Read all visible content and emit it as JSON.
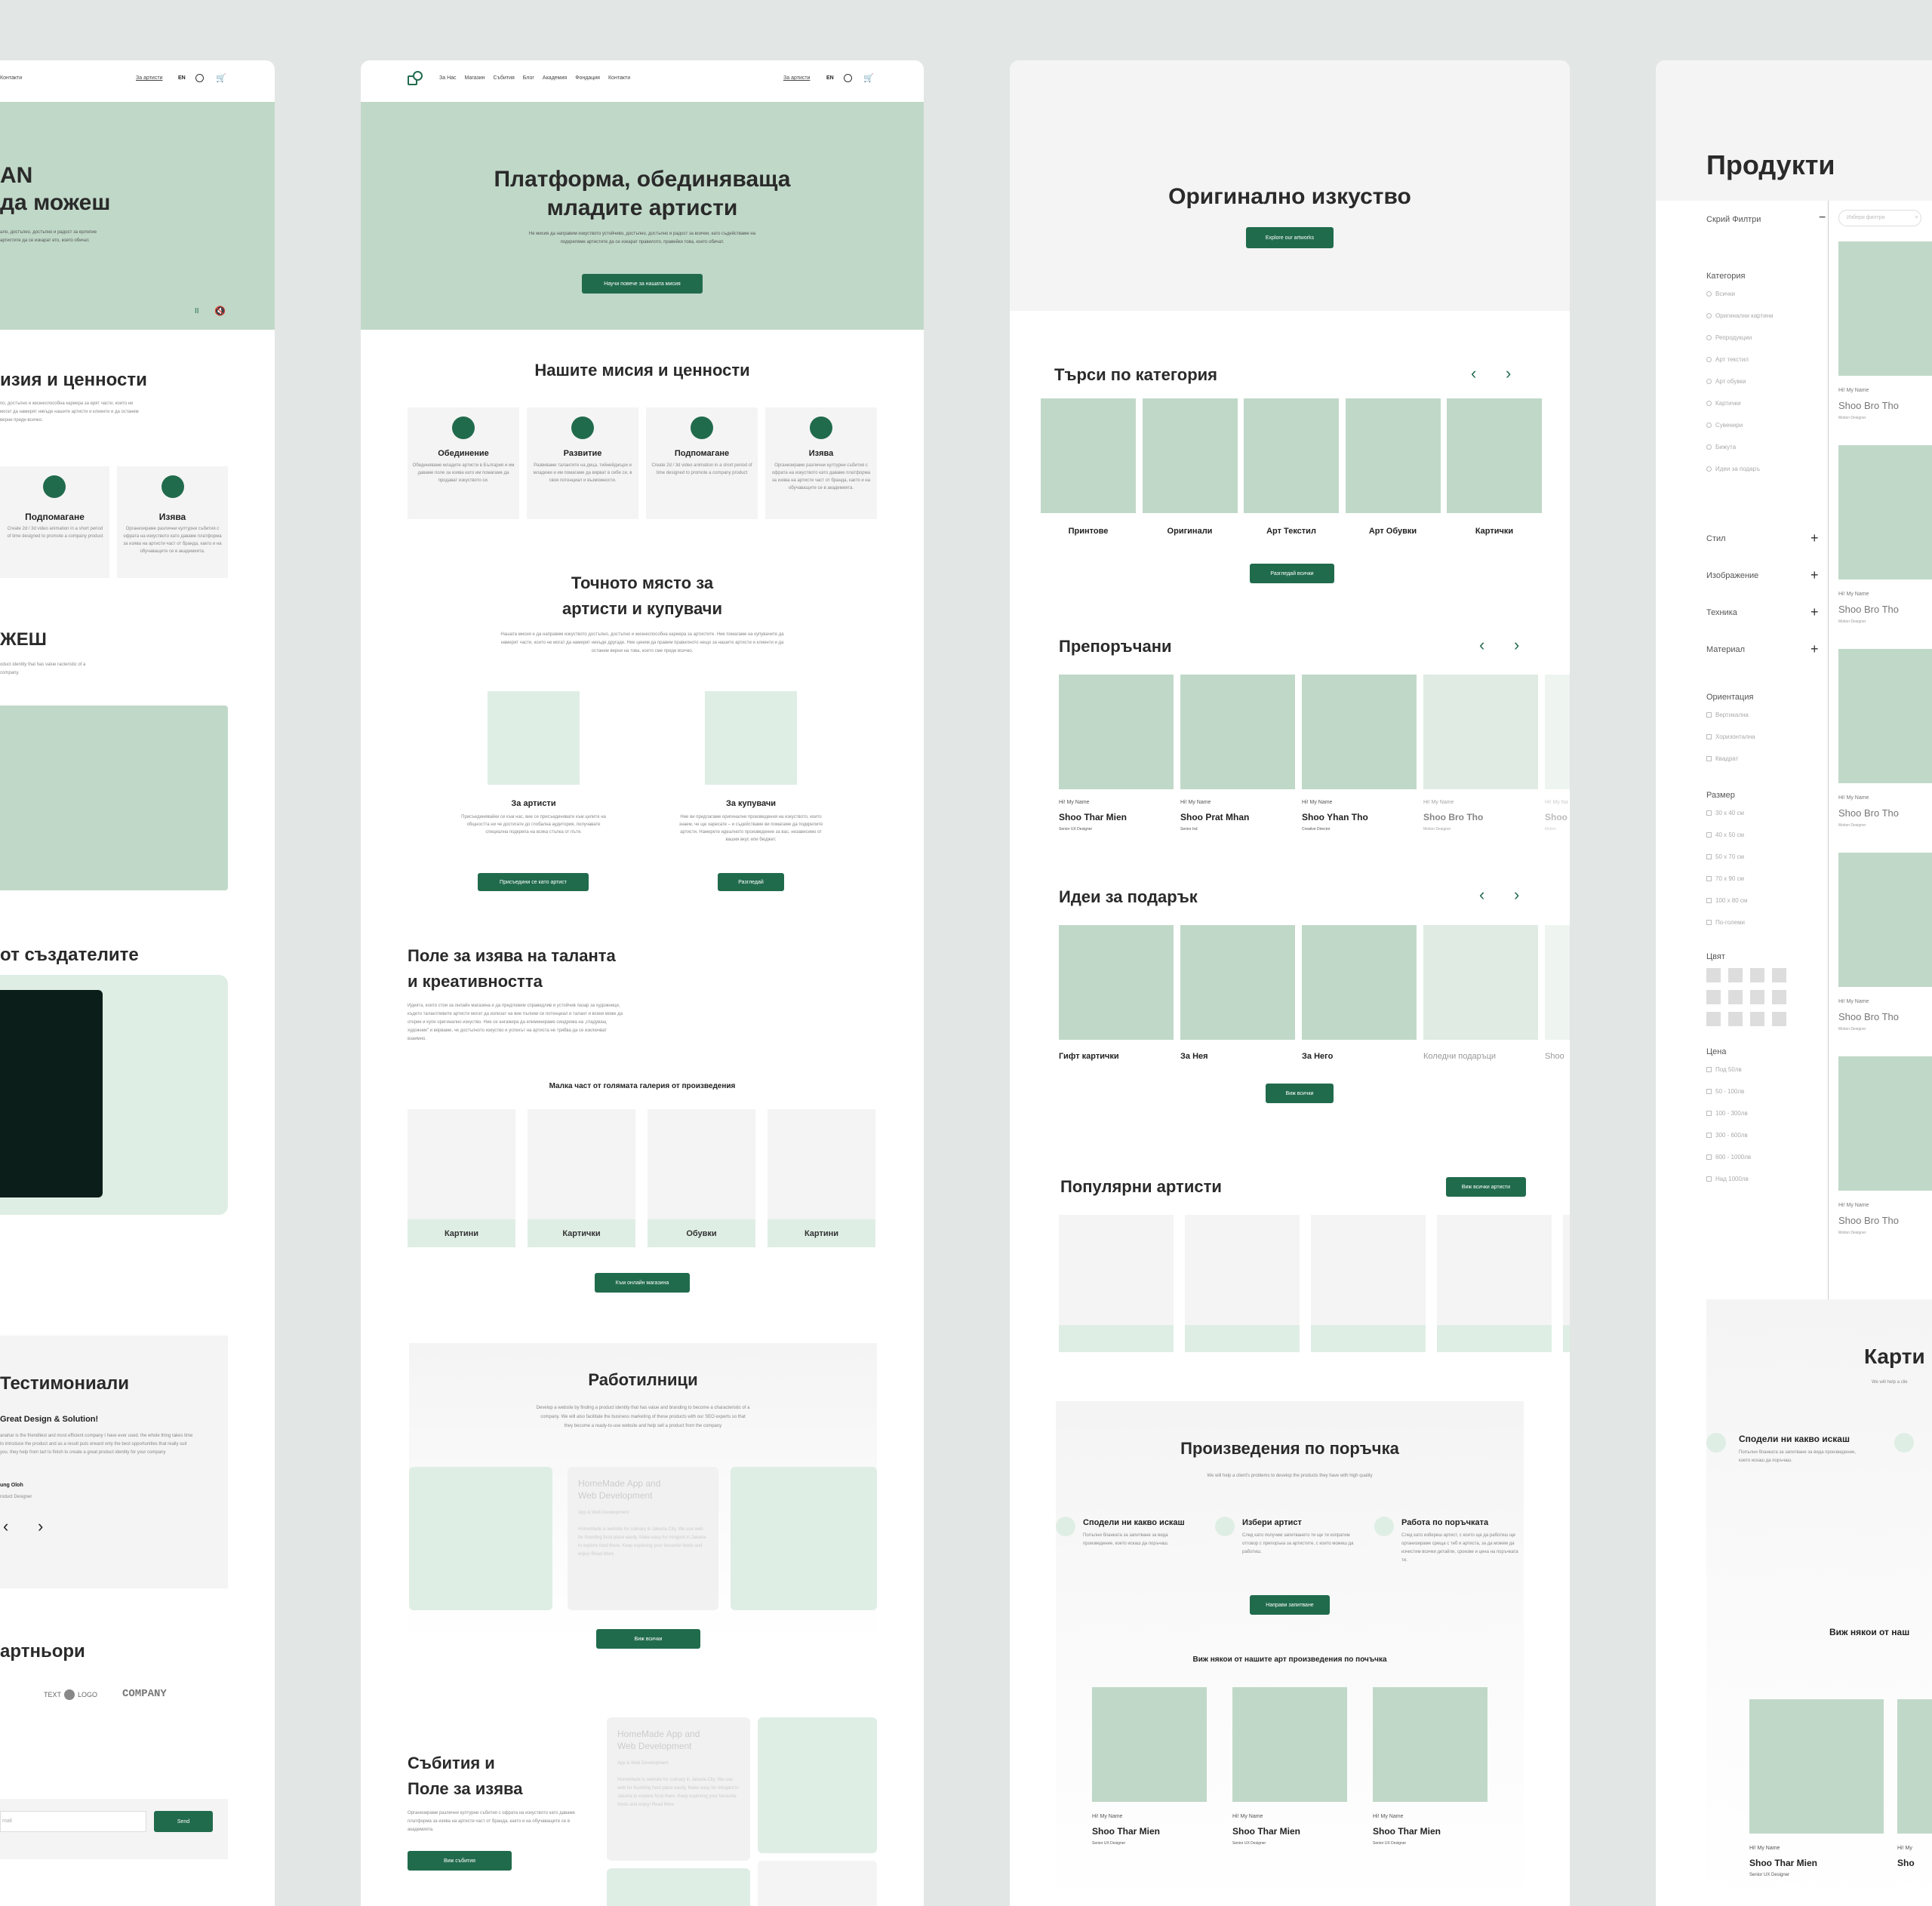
{
  "panel1": {
    "nav_contacts": "Контакти",
    "nav_artists": "За артисти",
    "lang": "EN",
    "hero_title_line1": "AN",
    "hero_title_line2": "да можеш",
    "hero_text": "ало, достъпно, достъпно и радост за ерлопие артистите да се изкарат ето, което обичат.",
    "pause": "II",
    "mission_title": "изия и ценности",
    "mission_text": "по, достъпно и жизнеспособна кариера за ерят части, които не могат да намерят някъде нашите артисти и клиенти и да останем верни преди всичко.",
    "card1_title": "Подпомагане",
    "card1_text": "Create 2d / 3d video animation in a short period of time designed to promote a company product",
    "card2_title": "Изява",
    "card2_text": "Организираме различни културни събития с офрата на изкуството като даваме платформа за изява на артисти част от бранда, както и на обучаващите се в академията.",
    "section3_title": "ЖЕШ",
    "section3_text": "oduct identity that has value racteristic of a company.",
    "creators_title": "от създателите",
    "testimonials_title": "Тестимониали",
    "testimonial_headline": "Great Design & Solution!",
    "testimonial_text": "anahar is the friendliest and most efficient company I have ever used. the whole thing takes time to introduce the product and as a result puts orward only the best opportunities that really suit you. they help from tart to finish to create a great product identity for your company",
    "testimonial_author": "ung Oloh",
    "testimonial_role": "roduct Designer",
    "partners_title": "артньори",
    "logo1": "TEXT",
    "logo1b": "LOGO",
    "logo2": "COMPANY",
    "email_placeholder": "mail",
    "send_label": "Send"
  },
  "panel2": {
    "nav": [
      "За Нас",
      "Магазин",
      "Събития",
      "Блог",
      "Академия",
      "Фондация",
      "Контакти"
    ],
    "nav_artists": "За артисти",
    "lang": "EN",
    "hero_title_line1": "Платформа, обединяваща",
    "hero_title_line2": "младите артисти",
    "hero_text": "Не мисия да направим изкуството устойчиво, достъпно, достъпно и радост за всички, като съдействаме на подкрепяме артистите да се изкарат правилото, правейки това, което обичат.",
    "hero_btn": "Научи повече за нашата мисия",
    "mission_title": "Нашите мисия и ценности",
    "values": [
      {
        "title": "Обединение",
        "text": "Обединяваме младите артисти в България и им даваме поле за изява като им помагаме да продават изкуството си."
      },
      {
        "title": "Развитие",
        "text": "Развиваме талантите на деца, тийнейджъри и младежи и им помагаме да вярват в себе си, в своя потенциал и възможности."
      },
      {
        "title": "Подпомагане",
        "text": "Create 2d / 3d video animation in a short period of time designed to promote a company product"
      },
      {
        "title": "Изява",
        "text": "Организираме различни културни събития с офрата на изкуството като даваме платформа за изява на артисти част от бранда, както и на обучаващите се в академията."
      }
    ],
    "place_title_line1": "Точното място за",
    "place_title_line2": "артисти и купувачи",
    "place_text": "Нашата мисия е да направим изкуството достъпно, достъпно и жизнеспособна кариера за артистите. Ние помагаме на купувачите да намерят части, които не могат да намерят никъде другаде. Ние ценим да правим правилното нещо за нашите артисти и клиенти и да останем верни на това, което сме преди всичко.",
    "for_artists_title": "За артисти",
    "for_artists_text": "Присъединявайки се към нас, вие се присъединявате към целите на общността ни че достигате до глобална аудитория, получавате специална подкрепа на всяка стъпка от пътя.",
    "for_artists_btn": "Присъедини се като артист",
    "for_buyers_title": "За купувачи",
    "for_buyers_text": "Ние ви предлагаме оригинални произведения на изкуството, които знаем, че ще харесате – и съдействаме ви помагаме да подкрепите артисти. Намерете идеалното произведение за вас, независимо от вашия вкус или бюджет.",
    "for_buyers_btn": "Разгледай",
    "talent_title_line1": "Поле за изява на таланта",
    "talent_title_line2": "и креативността",
    "talent_text": "Идеята, която стои за онлайн магазина е да предложим справедлив и устойчив пазар за художници, където талантливите артисти могат да излизат на вие пълнии си потенциал и талант и всеки може да открие и купи оригинално изкуство. Ние се ангажира да елиминираме синдрома на „гладуващ художник\" и вярваме, че достъпното изкуство и успехът на артиста не трябва да се изключват взаимно.",
    "gallery_title": "Малка част от голямата галерия от произведения",
    "gallery_items": [
      "Картини",
      "Картички",
      "Обувки",
      "Картини"
    ],
    "shop_btn": "Към онлайн магазина",
    "workshops_title": "Работилници",
    "workshops_text": "Develop a website by finding a product identity that has value and branding to become a characteristic of a company. We will also facilitate the business marketing of these products with our SEO experts so that they become a ready-to-use website and help sell a product from the company",
    "workshop_card_title": "HomeMade App and Web Development",
    "workshop_card_sub": "App & Web Development",
    "workshop_card_text": "HomeMade is website for culinary in Jakarta City. We use web for founding food place easily. Make easy for mingant in Jakarta to explore food there. Keep exploring your favourite foods and enjoy! Read More",
    "workshops_btn": "Виж всички",
    "events_title_line1": "Събития и",
    "events_title_line2": "Поле за изява",
    "events_text": "Организираме различни културни събития с офрата на изкуството като даваме платформа за изява на артисти част от бранда, както и на обучаващите се в академията.",
    "events_btn": "Виж събития",
    "event_card_title": "HomeMade App and Web Development",
    "event_card_sub": "App & Web Development",
    "event_card_text": "HomeMade is website for culinary in Jakarta City. We use web for founding food place easily. Make easy for mingant in Jakarta to explore food there. Keep exploring your favourite foods and enjoy! Read More"
  },
  "panel3": {
    "hero_title": "Оригинално изкуство",
    "hero_btn": "Explore our artworks",
    "category_title": "Търси по категория",
    "categories": [
      "Принтове",
      "Оригинали",
      "Арт Текстил",
      "Арт Обувки",
      "Картички"
    ],
    "category_btn": "Разгледай всички",
    "recommended_title": "Препоръчани",
    "recommended": [
      {
        "pre": "Hi! My Name",
        "name": "Shoo Thar Mien",
        "role": "Senior UX Designer"
      },
      {
        "pre": "Hi! My Name",
        "name": "Shoo Prat Mhan",
        "role": "Senior Ixd"
      },
      {
        "pre": "Hi! My Name",
        "name": "Shoo Yhan Tho",
        "role": "Creative Director"
      },
      {
        "pre": "Hi! My Name",
        "name": "Shoo Bro Tho",
        "role": "Motion Designer"
      },
      {
        "pre": "Hi! My Na",
        "name": "Shoo",
        "role": "Motion"
      }
    ],
    "gifts_title": "Идеи за подарък",
    "gifts": [
      "Гифт картички",
      "За Нея",
      "За Него",
      "Коледни подаръци",
      "Shoo"
    ],
    "gifts_btn": "Виж всички",
    "artists_title": "Популярни артисти",
    "artists_btn": "Виж всички артисти",
    "custom_title": "Произведения по поръчка",
    "custom_sub": "We will help a client's problems to develop the products they have with high quality",
    "steps": [
      {
        "title": "Сподели ни какво искаш",
        "text": "Попълни бланката за запитване за вида произведение, което искаш да поръчаш."
      },
      {
        "title": "Избери артист",
        "text": "След като получим запитването ти ще ти изпратим отговор с препоръка за артистите, с които можеш да работиш."
      },
      {
        "title": "Работа по поръчката",
        "text": "След като избереш артист, с които ще да работиш ще организираме среща с теб и артиста, за да можем да изчистим всички детайли, срокове и цена на поръчката ти."
      }
    ],
    "custom_btn": "Направи запитване",
    "custom_gallery_title": "Виж някои от нашите арт произведения по почъчка",
    "custom_items": [
      {
        "pre": "Hi! My Name",
        "name": "Shoo Thar Mien",
        "role": "Senior UX Designer"
      },
      {
        "pre": "Hi! My Name",
        "name": "Shoo Thar Mien",
        "role": "Senior UX Designer"
      },
      {
        "pre": "Hi! My Name",
        "name": "Shoo Thar Mien",
        "role": "Senior UX Designer"
      }
    ]
  },
  "panel4": {
    "title": "Продукти",
    "hide_filters": "Скрий Филтри",
    "filter_placeholder": "Избери филтри",
    "category_label": "Категория",
    "categories": [
      "Всички",
      "Оригинални картини",
      "Репродукции",
      "Арт текстил",
      "Арт обувки",
      "Картички",
      "Сувенири",
      "Бижута",
      "Идеи за подаръ"
    ],
    "style_label": "Стил",
    "image_label": "Изображение",
    "technique_label": "Техника",
    "material_label": "Материал",
    "orientation_label": "Ориентация",
    "orientations": [
      "Вертикална",
      "Хоризонтална",
      "Квадрат"
    ],
    "size_label": "Размер",
    "sizes": [
      "30 x 40 см",
      "40 x 50 см",
      "50 x 70 см",
      "70 x 90 см",
      "100 x 80 см",
      "По-големи"
    ],
    "color_label": "Цвят",
    "price_label": "Цена",
    "prices": [
      "Под 50лв",
      "50 - 100лв",
      "100 - 300лв",
      "300 - 600лв",
      "600 - 1000лв",
      "Над 1000лв"
    ],
    "products": [
      {
        "pre": "Hi! My Name",
        "name": "Shoo Bro Tho",
        "role": "Motion Designer"
      },
      {
        "pre": "Hi! My Name",
        "name": "Shoo Bro Tho",
        "role": "Motion Designer"
      },
      {
        "pre": "Hi! My Name",
        "name": "Shoo Bro Tho",
        "role": "Motion Designer"
      },
      {
        "pre": "Hi! My Name",
        "name": "Shoo Bro Tho",
        "role": "Motion Designer"
      },
      {
        "pre": "Hi! My Name",
        "name": "Shoo Bro Tho",
        "role": "Motion Designer"
      }
    ],
    "cards_title": "Карти",
    "cards_sub": "We will help a clie",
    "step_title": "Сподели ни какво искаш",
    "step_text": "Попълни бланката за запитване за вида произведение, което искаш да поръчаш.",
    "see_some": "Виж някои от наш",
    "item_pre": "Hi! My Name",
    "item_name": "Shoo Thar Mien",
    "item_role": "Senior UX Designer",
    "item2_pre": "Hi! My",
    "item2_name": "Sho"
  }
}
